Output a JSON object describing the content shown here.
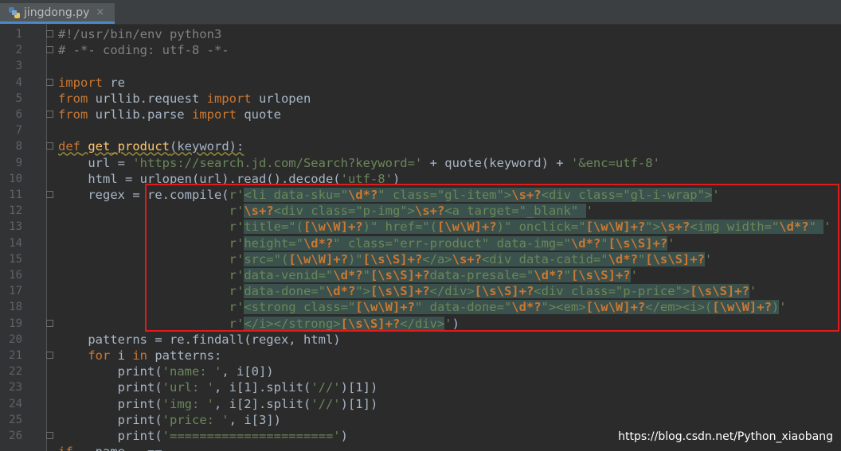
{
  "tab": {
    "filename": "jingdong.py",
    "close_glyph": "×"
  },
  "editor": {
    "lines": [
      {
        "n": "1",
        "fold": true,
        "segs": [
          {
            "c": "cm",
            "t": "#!/usr/bin/env python3"
          }
        ]
      },
      {
        "n": "2",
        "fold": true,
        "segs": [
          {
            "c": "cm",
            "t": "# -*- coding: utf-8 -*-"
          }
        ]
      },
      {
        "n": "3",
        "segs": []
      },
      {
        "n": "4",
        "fold": true,
        "segs": [
          {
            "c": "kw",
            "t": "import"
          },
          {
            "c": "",
            "t": " re"
          }
        ]
      },
      {
        "n": "5",
        "segs": [
          {
            "c": "kw",
            "t": "from"
          },
          {
            "c": "",
            "t": " urllib.request "
          },
          {
            "c": "kw",
            "t": "import"
          },
          {
            "c": "",
            "t": " urlopen"
          }
        ]
      },
      {
        "n": "6",
        "fold": true,
        "segs": [
          {
            "c": "kw",
            "t": "from"
          },
          {
            "c": "",
            "t": " urllib.parse "
          },
          {
            "c": "kw",
            "t": "import"
          },
          {
            "c": "",
            "t": " quote"
          }
        ]
      },
      {
        "n": "7",
        "segs": []
      },
      {
        "n": "8",
        "fold": true,
        "segs": [
          {
            "c": "kw sq",
            "t": "def"
          },
          {
            "c": "sq",
            "t": " "
          },
          {
            "c": "fn sq",
            "t": "get_product"
          },
          {
            "c": "sq",
            "t": "(keyword):"
          }
        ]
      },
      {
        "n": "9",
        "segs": [
          {
            "c": "",
            "t": "    url = "
          },
          {
            "c": "str",
            "t": "'https://search.jd.com/Search?keyword='"
          },
          {
            "c": "",
            "t": " + quote(keyword) + "
          },
          {
            "c": "str",
            "t": "'&enc=utf-8'"
          }
        ]
      },
      {
        "n": "10",
        "segs": [
          {
            "c": "",
            "t": "    html = urlopen(url).read().decode("
          },
          {
            "c": "str",
            "t": "'utf-8'"
          },
          {
            "c": "",
            "t": ")"
          }
        ]
      },
      {
        "n": "11",
        "fold": true,
        "segs": [
          {
            "c": "",
            "t": "    regex = re.compile("
          },
          {
            "c": "str",
            "t": "r'"
          },
          {
            "c": "str hl",
            "t": "<li data-sku=\""
          },
          {
            "c": "rx hl",
            "t": "\\d*?"
          },
          {
            "c": "str hl",
            "t": "\" class=\"gl-item\">"
          },
          {
            "c": "rx hl",
            "t": "\\s+?"
          },
          {
            "c": "str hl",
            "t": "<div class=\"gl-i-wrap\">"
          },
          {
            "c": "str",
            "t": "'"
          }
        ]
      },
      {
        "n": "12",
        "segs": [
          {
            "c": "",
            "t": "                       "
          },
          {
            "c": "str",
            "t": "r'"
          },
          {
            "c": "rx hl",
            "t": "\\s+?"
          },
          {
            "c": "str hl",
            "t": "<div class=\"p-img\">"
          },
          {
            "c": "rx hl",
            "t": "\\s+?"
          },
          {
            "c": "str hl",
            "t": "<a target=\"_blank\" "
          },
          {
            "c": "str",
            "t": "'"
          }
        ]
      },
      {
        "n": "13",
        "segs": [
          {
            "c": "",
            "t": "                       "
          },
          {
            "c": "str",
            "t": "r'"
          },
          {
            "c": "str hl",
            "t": "title=\"("
          },
          {
            "c": "rx hl",
            "t": "[\\w\\W]+?"
          },
          {
            "c": "str hl",
            "t": ")\" href=\"("
          },
          {
            "c": "rx hl",
            "t": "[\\w\\W]+?"
          },
          {
            "c": "str hl",
            "t": ")\" onclick=\""
          },
          {
            "c": "rx hl",
            "t": "[\\w\\W]+?"
          },
          {
            "c": "str hl",
            "t": "\">"
          },
          {
            "c": "rx hl",
            "t": "\\s+?"
          },
          {
            "c": "str hl",
            "t": "<img width=\""
          },
          {
            "c": "rx hl",
            "t": "\\d*?"
          },
          {
            "c": "str hl",
            "t": "\" "
          },
          {
            "c": "str",
            "t": "'"
          }
        ]
      },
      {
        "n": "14",
        "segs": [
          {
            "c": "",
            "t": "                       "
          },
          {
            "c": "str",
            "t": "r'"
          },
          {
            "c": "str hl",
            "t": "height=\""
          },
          {
            "c": "rx hl",
            "t": "\\d*?"
          },
          {
            "c": "str hl",
            "t": "\" class=\"err-product\" data-img=\""
          },
          {
            "c": "rx hl",
            "t": "\\d*?"
          },
          {
            "c": "str hl",
            "t": "\""
          },
          {
            "c": "rx hl",
            "t": "[\\s\\S]+?"
          },
          {
            "c": "str",
            "t": "'"
          }
        ]
      },
      {
        "n": "15",
        "segs": [
          {
            "c": "",
            "t": "                       "
          },
          {
            "c": "str",
            "t": "r'"
          },
          {
            "c": "str hl",
            "t": "src=\"("
          },
          {
            "c": "rx hl",
            "t": "[\\w\\W]+?"
          },
          {
            "c": "str hl",
            "t": ")\""
          },
          {
            "c": "rx hl",
            "t": "[\\s\\S]+?"
          },
          {
            "c": "str hl",
            "t": "</a>"
          },
          {
            "c": "rx hl",
            "t": "\\s+?"
          },
          {
            "c": "str hl",
            "t": "<div data-catid=\""
          },
          {
            "c": "rx hl",
            "t": "\\d*?"
          },
          {
            "c": "str hl",
            "t": "\""
          },
          {
            "c": "rx hl",
            "t": "[\\s\\S]+?"
          },
          {
            "c": "str",
            "t": "'"
          }
        ]
      },
      {
        "n": "16",
        "segs": [
          {
            "c": "",
            "t": "                       "
          },
          {
            "c": "str",
            "t": "r'"
          },
          {
            "c": "str hl",
            "t": "data-venid=\""
          },
          {
            "c": "rx hl",
            "t": "\\d*?"
          },
          {
            "c": "str hl",
            "t": "\""
          },
          {
            "c": "rx hl",
            "t": "[\\s\\S]+?"
          },
          {
            "c": "str hl",
            "t": "data-presale=\""
          },
          {
            "c": "rx hl",
            "t": "\\d*?"
          },
          {
            "c": "str hl",
            "t": "\""
          },
          {
            "c": "rx hl",
            "t": "[\\s\\S]+?"
          },
          {
            "c": "str",
            "t": "'"
          }
        ]
      },
      {
        "n": "17",
        "segs": [
          {
            "c": "",
            "t": "                       "
          },
          {
            "c": "str",
            "t": "r'"
          },
          {
            "c": "str hl",
            "t": "data-done=\""
          },
          {
            "c": "rx hl",
            "t": "\\d*?"
          },
          {
            "c": "str hl",
            "t": "\">"
          },
          {
            "c": "rx hl",
            "t": "[\\s\\S]+?"
          },
          {
            "c": "str hl",
            "t": "</div>"
          },
          {
            "c": "rx hl",
            "t": "[\\s\\S]+?"
          },
          {
            "c": "str hl",
            "t": "<div class=\"p-price\">"
          },
          {
            "c": "rx hl",
            "t": "[\\s\\S]+?"
          },
          {
            "c": "str",
            "t": "'"
          }
        ]
      },
      {
        "n": "18",
        "segs": [
          {
            "c": "",
            "t": "                       "
          },
          {
            "c": "str",
            "t": "r'"
          },
          {
            "c": "str hl",
            "t": "<strong class=\""
          },
          {
            "c": "rx hl",
            "t": "[\\w\\W]+?"
          },
          {
            "c": "str hl",
            "t": "\" data-done=\""
          },
          {
            "c": "rx hl",
            "t": "\\d*?"
          },
          {
            "c": "str hl",
            "t": "\"><em>"
          },
          {
            "c": "rx hl",
            "t": "[\\w\\W]+?"
          },
          {
            "c": "str hl",
            "t": "</em><i>("
          },
          {
            "c": "rx hl",
            "t": "[\\w\\W]+?"
          },
          {
            "c": "str hl",
            "t": ")"
          },
          {
            "c": "str",
            "t": "'"
          }
        ]
      },
      {
        "n": "19",
        "fold": true,
        "segs": [
          {
            "c": "",
            "t": "                       "
          },
          {
            "c": "str",
            "t": "r'"
          },
          {
            "c": "str hl",
            "t": "</i></strong>"
          },
          {
            "c": "rx hl",
            "t": "[\\s\\S]+?"
          },
          {
            "c": "str hl",
            "t": "</div>"
          },
          {
            "c": "str",
            "t": "'"
          },
          {
            "c": "",
            "t": ")"
          }
        ]
      },
      {
        "n": "20",
        "segs": [
          {
            "c": "",
            "t": "    patterns = re.findall(regex, html)"
          }
        ]
      },
      {
        "n": "21",
        "fold": true,
        "segs": [
          {
            "c": "",
            "t": "    "
          },
          {
            "c": "kw",
            "t": "for"
          },
          {
            "c": "",
            "t": " i "
          },
          {
            "c": "kw",
            "t": "in"
          },
          {
            "c": "",
            "t": " patterns:"
          }
        ]
      },
      {
        "n": "22",
        "segs": [
          {
            "c": "",
            "t": "        print("
          },
          {
            "c": "str",
            "t": "'name: '"
          },
          {
            "c": "",
            "t": ", i[0])"
          }
        ]
      },
      {
        "n": "23",
        "segs": [
          {
            "c": "",
            "t": "        print("
          },
          {
            "c": "str",
            "t": "'url: '"
          },
          {
            "c": "",
            "t": ", i[1].split("
          },
          {
            "c": "str",
            "t": "'//'"
          },
          {
            "c": "",
            "t": ")[1])"
          }
        ]
      },
      {
        "n": "24",
        "segs": [
          {
            "c": "",
            "t": "        print("
          },
          {
            "c": "str",
            "t": "'img: '"
          },
          {
            "c": "",
            "t": ", i[2].split("
          },
          {
            "c": "str",
            "t": "'//'"
          },
          {
            "c": "",
            "t": ")[1])"
          }
        ]
      },
      {
        "n": "25",
        "segs": [
          {
            "c": "",
            "t": "        print("
          },
          {
            "c": "str",
            "t": "'price: '"
          },
          {
            "c": "",
            "t": ", i[3])"
          }
        ]
      },
      {
        "n": "26",
        "fold": true,
        "segs": [
          {
            "c": "",
            "t": "        print("
          },
          {
            "c": "str",
            "t": "'======================'"
          },
          {
            "c": "",
            "t": ")"
          }
        ]
      },
      {
        "n": "",
        "segs": [
          {
            "c": "kw",
            "t": "if"
          },
          {
            "c": "",
            "t": " __name__ =="
          }
        ]
      }
    ]
  },
  "watermark": "https://blog.csdn.net/Python_xiaobang",
  "colors": {
    "background": "#2b2b2b",
    "keyword": "#cc7832",
    "string": "#6a8759",
    "comment": "#808080",
    "function": "#ffc66d",
    "highlight_box": "#e11a1a"
  }
}
